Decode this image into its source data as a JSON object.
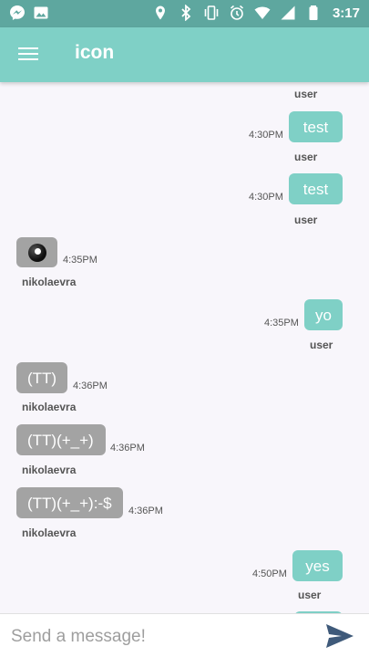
{
  "status_bar": {
    "time": "3:17",
    "left_icons": [
      "messenger-icon",
      "image-icon"
    ],
    "right_icons": [
      "location-icon",
      "bluetooth-icon",
      "vibrate-icon",
      "alarm-icon",
      "wifi-icon",
      "signal-icon",
      "battery-icon"
    ]
  },
  "app_bar": {
    "title": "icon",
    "menu_icon": "hamburger-menu-icon"
  },
  "messages": [
    {
      "side": "me",
      "text": "",
      "time": "",
      "sender": "user"
    },
    {
      "side": "me",
      "text": "test",
      "time": "4:30PM",
      "sender": "user"
    },
    {
      "side": "me",
      "text": "test",
      "time": "4:30PM",
      "sender": "user"
    },
    {
      "side": "them",
      "text": "",
      "icon": "eight-ball-icon",
      "time": "4:35PM",
      "sender": "nikolaevra"
    },
    {
      "side": "me",
      "text": "yo",
      "time": "4:35PM",
      "sender": "user"
    },
    {
      "side": "them",
      "text": "(TT)",
      "time": "4:36PM",
      "sender": "nikolaevra"
    },
    {
      "side": "them",
      "text": "(TT)(+_+)",
      "time": "4:36PM",
      "sender": "nikolaevra"
    },
    {
      "side": "them",
      "text": "(TT)(+_+):-$",
      "time": "4:36PM",
      "sender": "nikolaevra"
    },
    {
      "side": "me",
      "text": "yes",
      "time": "4:50PM",
      "sender": "user"
    }
  ],
  "composer": {
    "placeholder": "Send a message!",
    "value": "",
    "send_icon": "send-icon"
  },
  "colors": {
    "status_bar": "#5ea79f",
    "app_bar": "#7fd0c6",
    "my_bubble": "#7fd0c6",
    "their_bubble": "#a3a3a3",
    "background": "#f8f6fb",
    "send_icon": "#3f5a7a"
  }
}
